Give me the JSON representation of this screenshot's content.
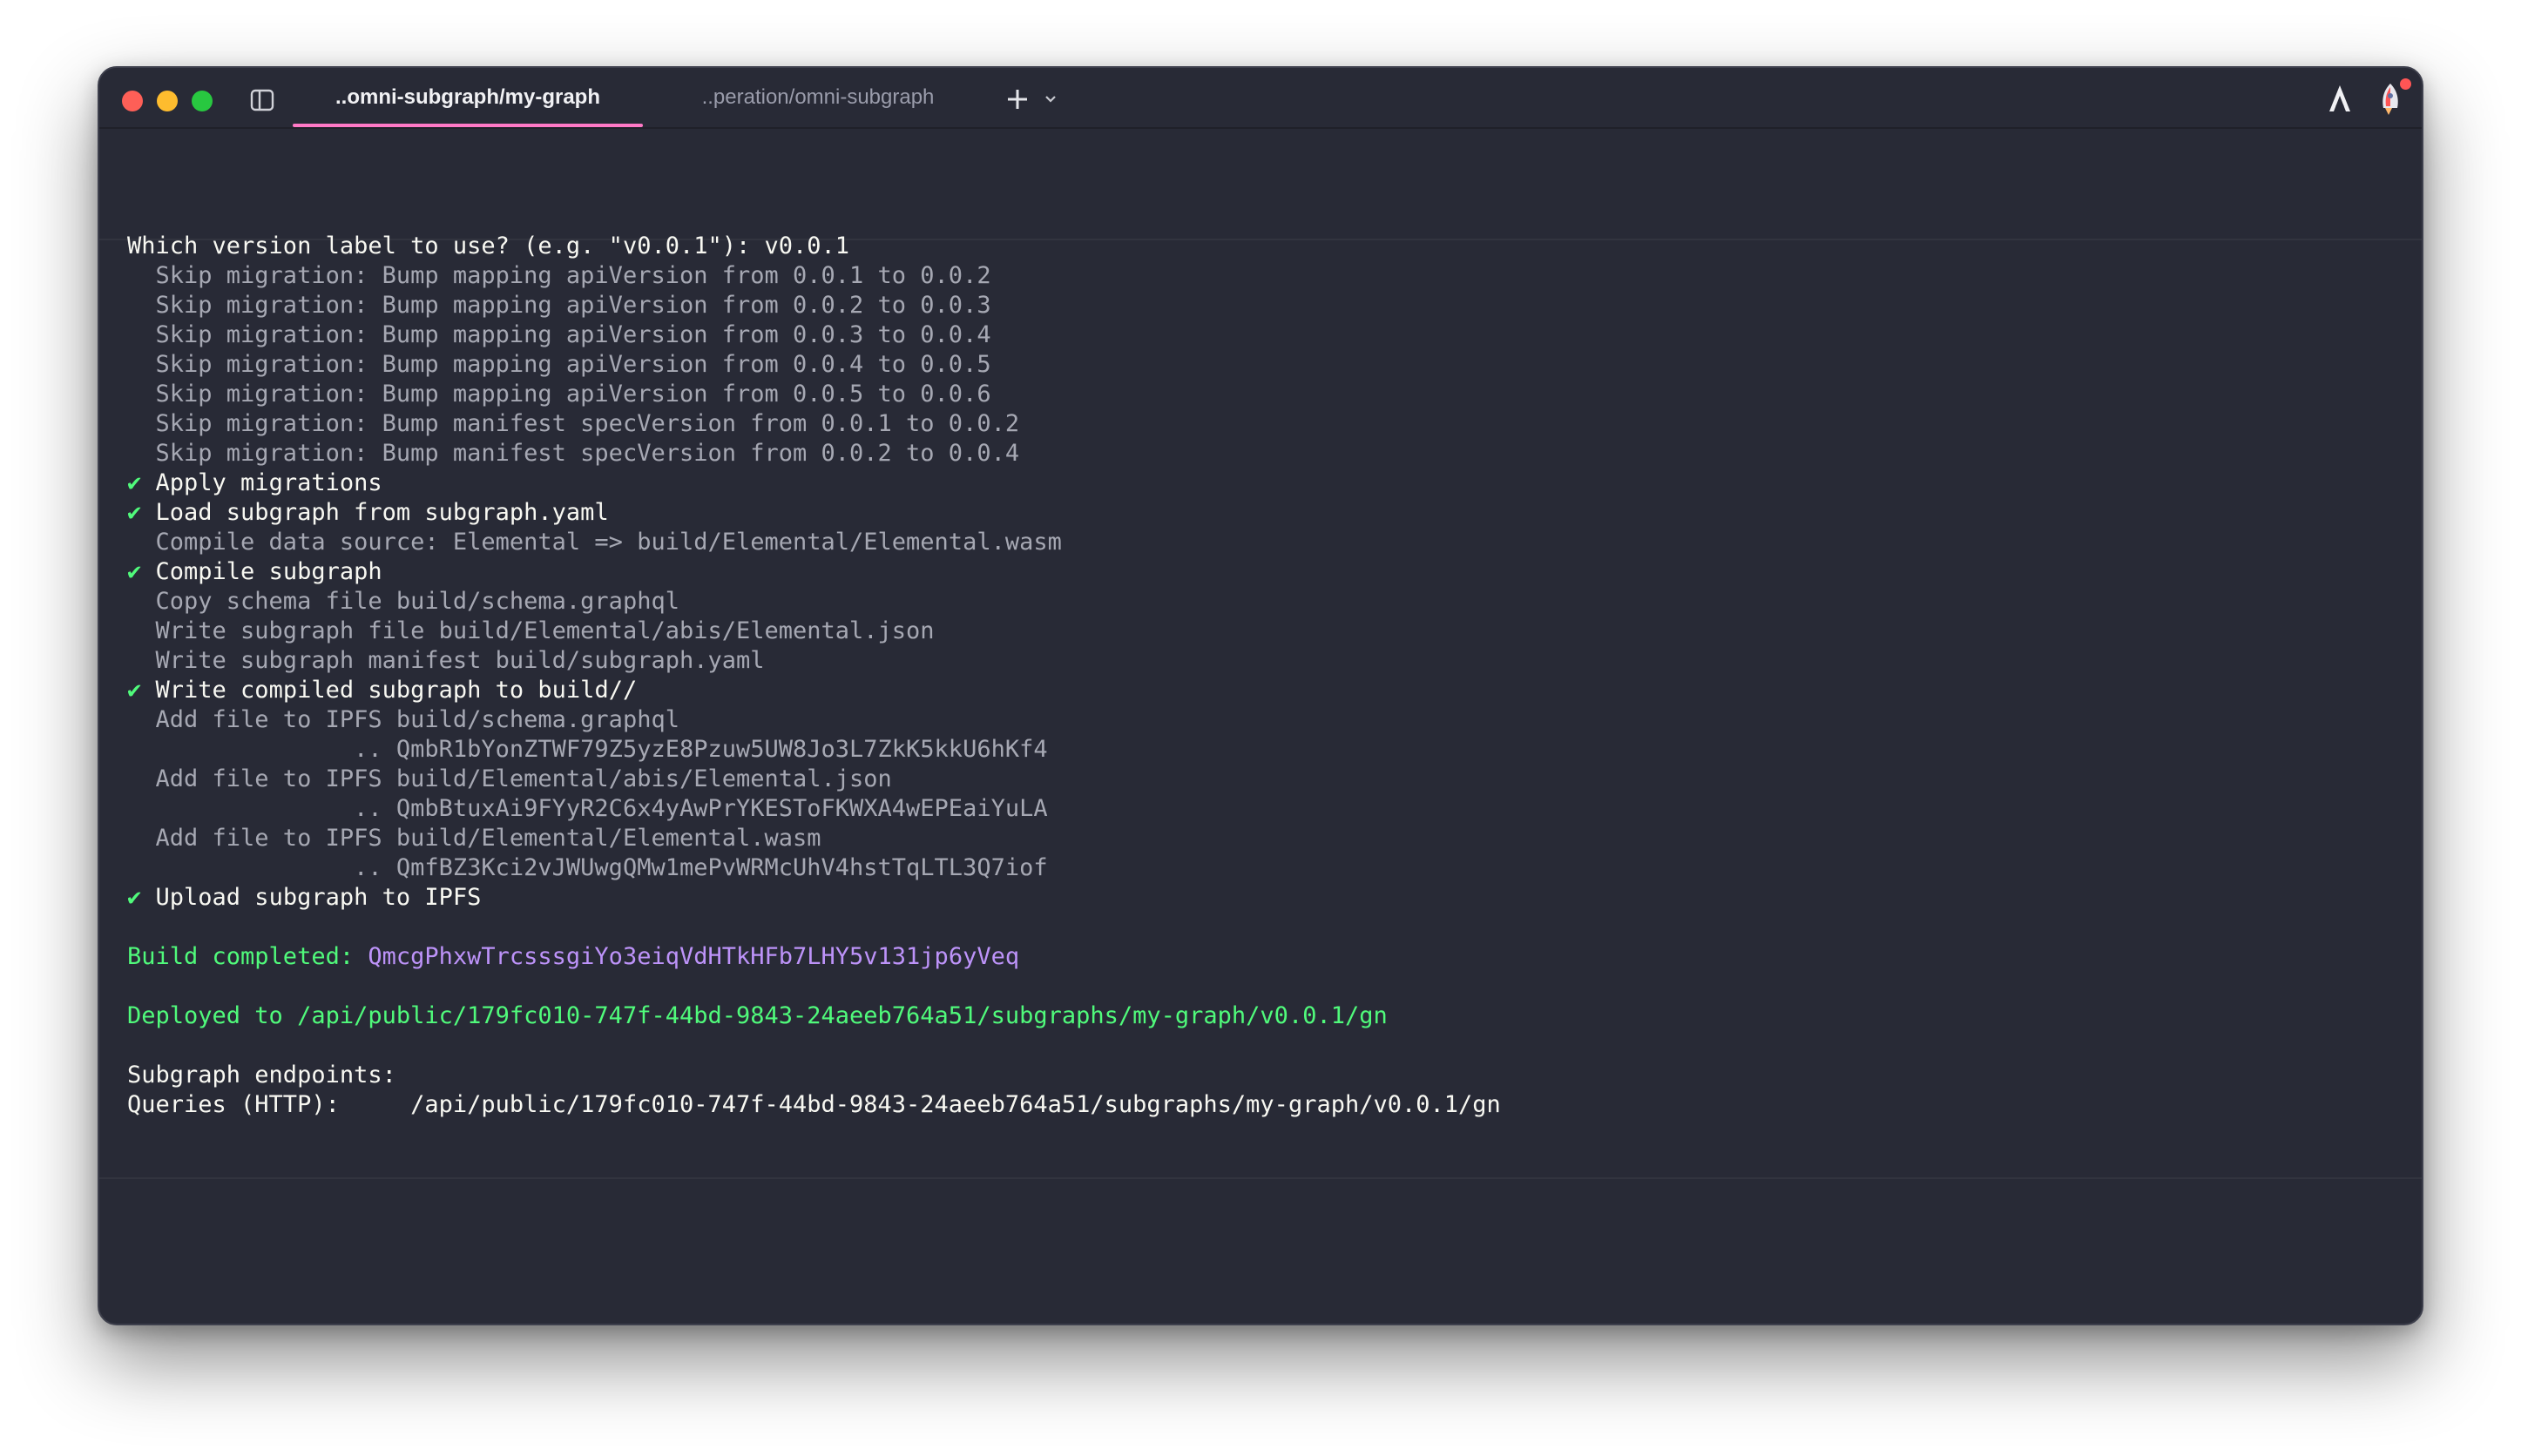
{
  "window": {
    "tabs": [
      {
        "label": "..omni-subgraph/my-graph",
        "active": true
      },
      {
        "label": "..peration/omni-subgraph",
        "active": false
      }
    ],
    "new_tab_glyph": "+",
    "icons": {
      "sidebar_toggle": "sidebar-toggle-icon",
      "chevron": "chevron-down-icon",
      "app_icon_1": "a-logo-icon",
      "app_icon_2": "rocket-icon"
    },
    "colors": {
      "background": "#282a36",
      "active_tab_underline": "#ff79c6",
      "success": "#50fa7b",
      "hash": "#bd93f9",
      "dim_text": "#a6a8b3"
    }
  },
  "terminal": {
    "lines": [
      {
        "kind": "prompt",
        "text": "Which version label to use? (e.g. \"v0.0.1\"): v0.0.1"
      },
      {
        "kind": "dim",
        "text": "  Skip migration: Bump mapping apiVersion from 0.0.1 to 0.0.2"
      },
      {
        "kind": "dim",
        "text": "  Skip migration: Bump mapping apiVersion from 0.0.2 to 0.0.3"
      },
      {
        "kind": "dim",
        "text": "  Skip migration: Bump mapping apiVersion from 0.0.3 to 0.0.4"
      },
      {
        "kind": "dim",
        "text": "  Skip migration: Bump mapping apiVersion from 0.0.4 to 0.0.5"
      },
      {
        "kind": "dim",
        "text": "  Skip migration: Bump mapping apiVersion from 0.0.5 to 0.0.6"
      },
      {
        "kind": "dim",
        "text": "  Skip migration: Bump manifest specVersion from 0.0.1 to 0.0.2"
      },
      {
        "kind": "dim",
        "text": "  Skip migration: Bump manifest specVersion from 0.0.2 to 0.0.4"
      },
      {
        "kind": "check",
        "mark": "✔",
        "text": " Apply migrations"
      },
      {
        "kind": "check",
        "mark": "✔",
        "text": " Load subgraph from subgraph.yaml"
      },
      {
        "kind": "dim",
        "text": "  Compile data source: Elemental => build/Elemental/Elemental.wasm"
      },
      {
        "kind": "check",
        "mark": "✔",
        "text": " Compile subgraph"
      },
      {
        "kind": "dim",
        "text": "  Copy schema file build/schema.graphql"
      },
      {
        "kind": "dim",
        "text": "  Write subgraph file build/Elemental/abis/Elemental.json"
      },
      {
        "kind": "dim",
        "text": "  Write subgraph manifest build/subgraph.yaml"
      },
      {
        "kind": "check",
        "mark": "✔",
        "text": " Write compiled subgraph to build//"
      },
      {
        "kind": "dim",
        "text": "  Add file to IPFS build/schema.graphql"
      },
      {
        "kind": "dim",
        "text": "                .. QmbR1bYonZTWF79Z5yzE8Pzuw5UW8Jo3L7ZkK5kkU6hKf4"
      },
      {
        "kind": "dim",
        "text": "  Add file to IPFS build/Elemental/abis/Elemental.json"
      },
      {
        "kind": "dim",
        "text": "                .. QmbBtuxAi9FYyR2C6x4yAwPrYKESToFKWXA4wEPEaiYuLA"
      },
      {
        "kind": "dim",
        "text": "  Add file to IPFS build/Elemental/Elemental.wasm"
      },
      {
        "kind": "dim",
        "text": "                .. QmfBZ3Kci2vJWUwgQMw1mePvWRMcUhV4hstTqLTL3Q7iof"
      },
      {
        "kind": "check",
        "mark": "✔",
        "text": " Upload subgraph to IPFS"
      },
      {
        "kind": "blank",
        "text": ""
      },
      {
        "kind": "build",
        "label": "Build completed: ",
        "hash": "QmcgPhxwTrcsssgiYo3eiqVdHTkHFb7LHY5v131jp6yVeq"
      },
      {
        "kind": "blank",
        "text": ""
      },
      {
        "kind": "green",
        "text": "Deployed to /api/public/179fc010-747f-44bd-9843-24aeeb764a51/subgraphs/my-graph/v0.0.1/gn"
      },
      {
        "kind": "blank",
        "text": ""
      },
      {
        "kind": "white",
        "text": "Subgraph endpoints:"
      },
      {
        "kind": "white",
        "text": "Queries (HTTP):     /api/public/179fc010-747f-44bd-9843-24aeeb764a51/subgraphs/my-graph/v0.0.1/gn"
      }
    ]
  }
}
